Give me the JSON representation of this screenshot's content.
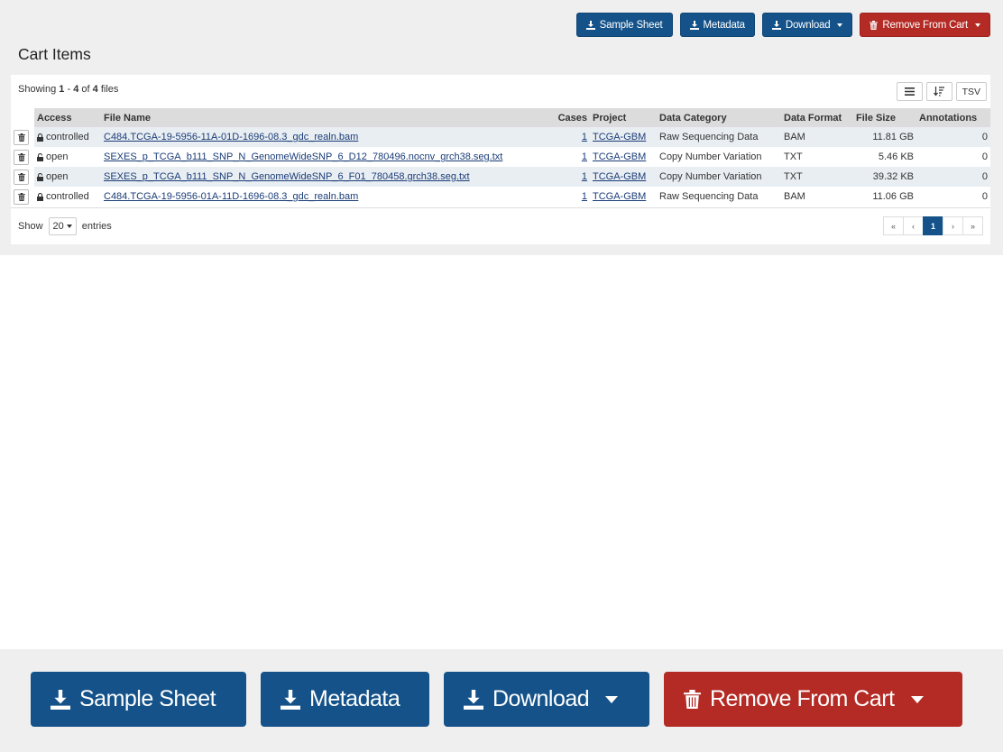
{
  "toolbar": {
    "sample_sheet": "Sample Sheet",
    "metadata": "Metadata",
    "download": "Download",
    "remove_from_cart": "Remove From Cart"
  },
  "page": {
    "title": "Cart Items"
  },
  "summary": {
    "prefix": "Showing",
    "start": "1",
    "sep": "-",
    "end": "4",
    "of": "of",
    "total": "4",
    "suffix": "files"
  },
  "table_controls": {
    "tsv_label": "TSV"
  },
  "table": {
    "columns": [
      "Access",
      "File Name",
      "Cases",
      "Project",
      "Data Category",
      "Data Format",
      "File Size",
      "Annotations"
    ],
    "rows": [
      {
        "access": "controlled",
        "file_name": "C484.TCGA-19-5956-11A-01D-1696-08.3_gdc_realn.bam",
        "cases": "1",
        "project": "TCGA-GBM",
        "data_category": "Raw Sequencing Data",
        "data_format": "BAM",
        "file_size": "11.81 GB",
        "annotations": "0"
      },
      {
        "access": "open",
        "file_name": "SEXES_p_TCGA_b111_SNP_N_GenomeWideSNP_6_D12_780496.nocnv_grch38.seg.txt",
        "cases": "1",
        "project": "TCGA-GBM",
        "data_category": "Copy Number Variation",
        "data_format": "TXT",
        "file_size": "5.46 KB",
        "annotations": "0"
      },
      {
        "access": "open",
        "file_name": "SEXES_p_TCGA_b111_SNP_N_GenomeWideSNP_6_F01_780458.grch38.seg.txt",
        "cases": "1",
        "project": "TCGA-GBM",
        "data_category": "Copy Number Variation",
        "data_format": "TXT",
        "file_size": "39.32 KB",
        "annotations": "0"
      },
      {
        "access": "controlled",
        "file_name": "C484.TCGA-19-5956-01A-11D-1696-08.3_gdc_realn.bam",
        "cases": "1",
        "project": "TCGA-GBM",
        "data_category": "Raw Sequencing Data",
        "data_format": "BAM",
        "file_size": "11.06 GB",
        "annotations": "0"
      }
    ]
  },
  "footer": {
    "show_label": "Show",
    "page_size": "20",
    "entries_label": "entries",
    "pagination": [
      "«",
      "‹",
      "1",
      "›",
      "»"
    ],
    "current_page": "1"
  },
  "colors": {
    "primary_blue": "#145289",
    "danger_red": "#b42a24",
    "row_stripe": "#e9eef2",
    "header_gray": "#dcdcdc"
  },
  "icons": {
    "download": "download-icon",
    "trash": "trash-icon",
    "lock": "lock-icon",
    "unlock": "unlock-icon",
    "list": "list-icon",
    "sort": "sort-icon"
  }
}
